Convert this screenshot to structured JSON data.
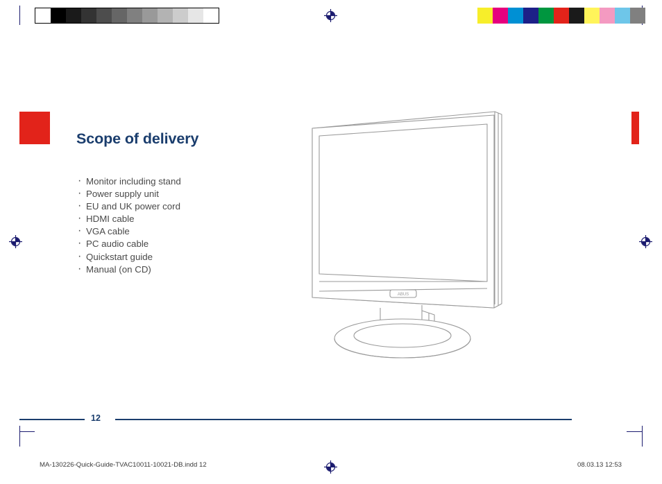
{
  "document": {
    "title": "Scope of delivery",
    "page_number": "12",
    "footer_filename": "MA-130226-Quick-Guide-TVAC10011-10021-DB.indd   12",
    "footer_timestamp": "08.03.13   12:53"
  },
  "delivery_items": [
    "Monitor including stand",
    "Power supply unit",
    "EU and UK power cord",
    "HDMI cable",
    "VGA cable",
    "PC audio cable",
    "Quickstart guide",
    "Manual (on CD)"
  ],
  "illustration": {
    "name": "lcd-monitor-with-stand",
    "brand_plate": "ABUS"
  },
  "colors": {
    "title": "#1a3d6d",
    "tab_red": "#e2231a",
    "rule": "#1a3d6d",
    "body_text": "#4a4a4a"
  },
  "print_marks": {
    "greyscale_swatches": [
      "#ffffff",
      "#000000",
      "#1a1a1a",
      "#333333",
      "#4d4d4d",
      "#666666",
      "#808080",
      "#999999",
      "#b3b3b3",
      "#cccccc",
      "#e6e6e6",
      "#ffffff"
    ],
    "color_swatches": [
      "#ffffff",
      "#f7ee2a",
      "#e6007e",
      "#0090d4",
      "#1d2088",
      "#00963f",
      "#e2231a",
      "#1a1a1a",
      "#fff45a",
      "#f49ac1",
      "#6ec6e9",
      "#808080"
    ],
    "registration_icon": "registration-target-icon"
  }
}
